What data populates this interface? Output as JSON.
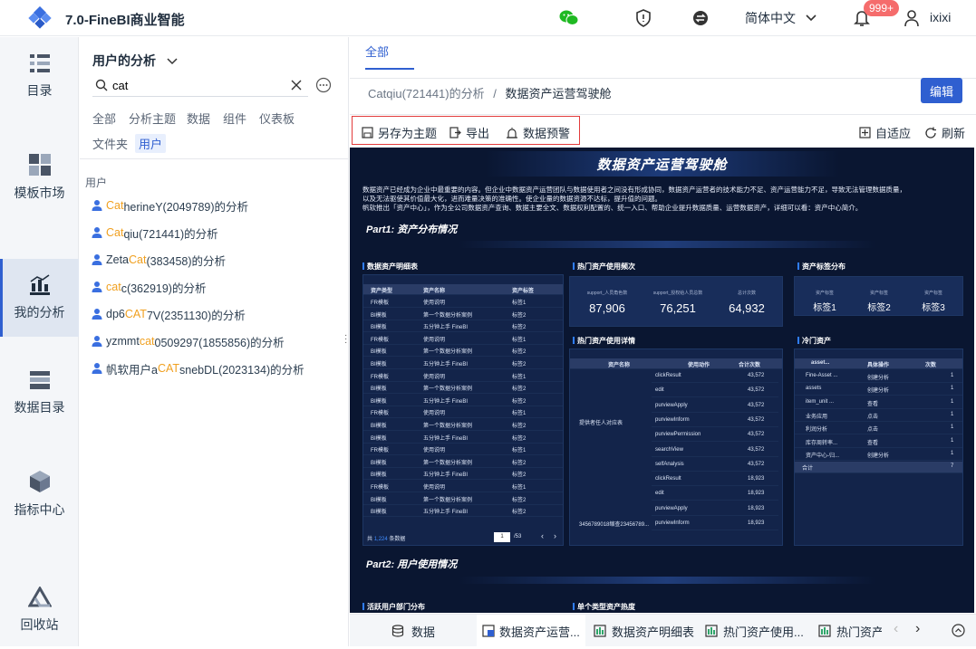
{
  "app": {
    "title": "7.0-FineBI商业智能"
  },
  "topbar": {
    "language": "简体中文",
    "badge": "999+",
    "user": "ixixi"
  },
  "leftnav": [
    {
      "label": "目录",
      "icon": "catalog-icon"
    },
    {
      "label": "模板市场",
      "icon": "template-icon"
    },
    {
      "label": "我的分析",
      "icon": "analysis-icon",
      "active": true
    },
    {
      "label": "数据目录",
      "icon": "data-catalog-icon"
    },
    {
      "label": "指标中心",
      "icon": "metric-icon"
    },
    {
      "label": "回收站",
      "icon": "recycle-icon"
    }
  ],
  "panel": {
    "title": "用户的分析",
    "search_value": "cat",
    "filters": [
      "全部",
      "分析主题",
      "数据",
      "组件",
      "仪表板",
      "文件夹",
      "用户"
    ],
    "selected_filter": "用户",
    "section": "用户",
    "users": [
      {
        "pre": "",
        "hl": "Cat",
        "post": "herineY(2049789)的分析"
      },
      {
        "pre": "",
        "hl": "Cat",
        "post": "qiu(721441)的分析"
      },
      {
        "pre": "Zeta",
        "hl": "Cat",
        "post": "(383458)的分析"
      },
      {
        "pre": "",
        "hl": "cat",
        "post": "c(362919)的分析"
      },
      {
        "pre": "dp6",
        "hl": "CAT",
        "post": "7V(2351130)的分析"
      },
      {
        "pre": "yzmmt",
        "hl": "cat",
        "post": "0509297(1855856)的分析"
      },
      {
        "pre": "帆软用户a",
        "hl": "CAT",
        "post": "snebDL(2023134)的分析"
      }
    ]
  },
  "content": {
    "tab_all": "全部",
    "breadcrumb_parent": "Catqiu(721441)的分析",
    "breadcrumb_sep": "/",
    "breadcrumb_current": "数据资产运营驾驶舱",
    "edit_label": "编辑",
    "toolbar": {
      "save_as": "另存为主题",
      "export": "导出",
      "alert": "数据预警",
      "fit": "自适应",
      "refresh": "刷新"
    }
  },
  "dashboard": {
    "title": "数据资产运营驾驶舱",
    "desc1": "数据资产已经成为企业中最重要的内容。但企业中数据资产运营团队与数据使用者之间没有形成协同，数据资产运营者的技术能力不足、资产运营能力不足，导致无法管理数据质量，",
    "desc2": "以及无法驱使其价值最大化，进而难量决策的准确性。使企业量的数据资源不达标，提升值的问题。",
    "desc3": "帆软推出「资产中心」，作为全公司数据资产查询、数据主要全文、数据权利配置的、统一入口、帮助企业提升数据质量、运营数据资产，详细可以看：资产中心简介。",
    "part1": "Part1: 资产分布情况",
    "part2": "Part2: 用户使用情况",
    "p_detail": "数据资产明细表",
    "p_freq": "热门资产使用频次",
    "p_tags": "资产标签分布",
    "p_hotdetail": "热门资产使用详情",
    "p_cold": "冷门资产",
    "p_active": "活跃用户部门分布",
    "p_single": "单个类型资产热度",
    "detail_headers": [
      "资产类型",
      "资产名称",
      "资产标签"
    ],
    "detail_rows": [
      [
        "FR模板",
        "使用说明",
        "标签1"
      ],
      [
        "BI模板",
        "第一个数据分析案例",
        "标签2"
      ],
      [
        "BI模板",
        "五分钟上手 FineBI",
        "标签2"
      ],
      [
        "FR模板",
        "使用说明",
        "标签1"
      ],
      [
        "BI模板",
        "第一个数据分析案例",
        "标签2"
      ],
      [
        "BI模板",
        "五分钟上手 FineBI",
        "标签2"
      ],
      [
        "FR模板",
        "使用说明",
        "标签1"
      ],
      [
        "BI模板",
        "第一个数据分析案例",
        "标签2"
      ],
      [
        "BI模板",
        "五分钟上手 FineBI",
        "标签2"
      ],
      [
        "FR模板",
        "使用说明",
        "标签1"
      ],
      [
        "BI模板",
        "第一个数据分析案例",
        "标签2"
      ],
      [
        "BI模板",
        "五分钟上手 FineBI",
        "标签2"
      ],
      [
        "FR模板",
        "使用说明",
        "标签1"
      ],
      [
        "BI模板",
        "第一个数据分析案例",
        "标签2"
      ],
      [
        "BI模板",
        "五分钟上手 FineBI",
        "标签2"
      ],
      [
        "FR模板",
        "使用说明",
        "标签1"
      ],
      [
        "BI模板",
        "第一个数据分析案例",
        "标签2"
      ],
      [
        "BI模板",
        "五分钟上手 FineBI",
        "标签2"
      ]
    ],
    "detail_footer": {
      "prefix": "共",
      "count": "1,224",
      "suffix": "条数据",
      "page": "1",
      "pages": "/53"
    },
    "kpis": [
      {
        "label": "support_人员角色数",
        "value": "87,906"
      },
      {
        "label": "support_授权给人员总数",
        "value": "76,251"
      },
      {
        "label": "总计次数",
        "value": "64,932"
      }
    ],
    "tags": [
      {
        "label": "资产标签",
        "value": "标签1"
      },
      {
        "label": "资产标签",
        "value": "标签2"
      },
      {
        "label": "资产标签",
        "value": "标签3"
      }
    ],
    "hot_headers": [
      "资产名称",
      "使用动作",
      "合计次数"
    ],
    "hot_group1": "提供者任人对应表",
    "hot_group2": "3456789018缩查23456789...",
    "hot_rows": [
      [
        "clickResult",
        "43,572"
      ],
      [
        "edit",
        "43,572"
      ],
      [
        "purviewApply",
        "43,572"
      ],
      [
        "purviewInform",
        "43,572"
      ],
      [
        "purviewPermission",
        "43,572"
      ],
      [
        "searchView",
        "43,572"
      ],
      [
        "selfAnalysis",
        "43,572"
      ],
      [
        "clickResult",
        "18,923"
      ],
      [
        "edit",
        "18,923"
      ],
      [
        "purviewApply",
        "18,923"
      ],
      [
        "purviewInform",
        "18,923"
      ]
    ],
    "cold_headers": [
      "asset...",
      "具体操作",
      "次数"
    ],
    "cold_rows": [
      [
        "Fine-Asset ...",
        "创建分析",
        "1"
      ],
      [
        "assets",
        "创建分析",
        "1"
      ],
      [
        "item_unit ...",
        "查看",
        "1"
      ],
      [
        "业务应用",
        "点击",
        "1"
      ],
      [
        "利润分析",
        "点击",
        "1"
      ],
      [
        "库存周转率...",
        "查看",
        "1"
      ],
      [
        "资产中心-归...",
        "创建分析",
        "1"
      ]
    ],
    "cold_total": [
      "合计",
      "7"
    ]
  },
  "bottom_tabs": [
    "数据",
    "数据资产运营...",
    "数据资产明细表",
    "热门资产使用...",
    "热门资产"
  ]
}
